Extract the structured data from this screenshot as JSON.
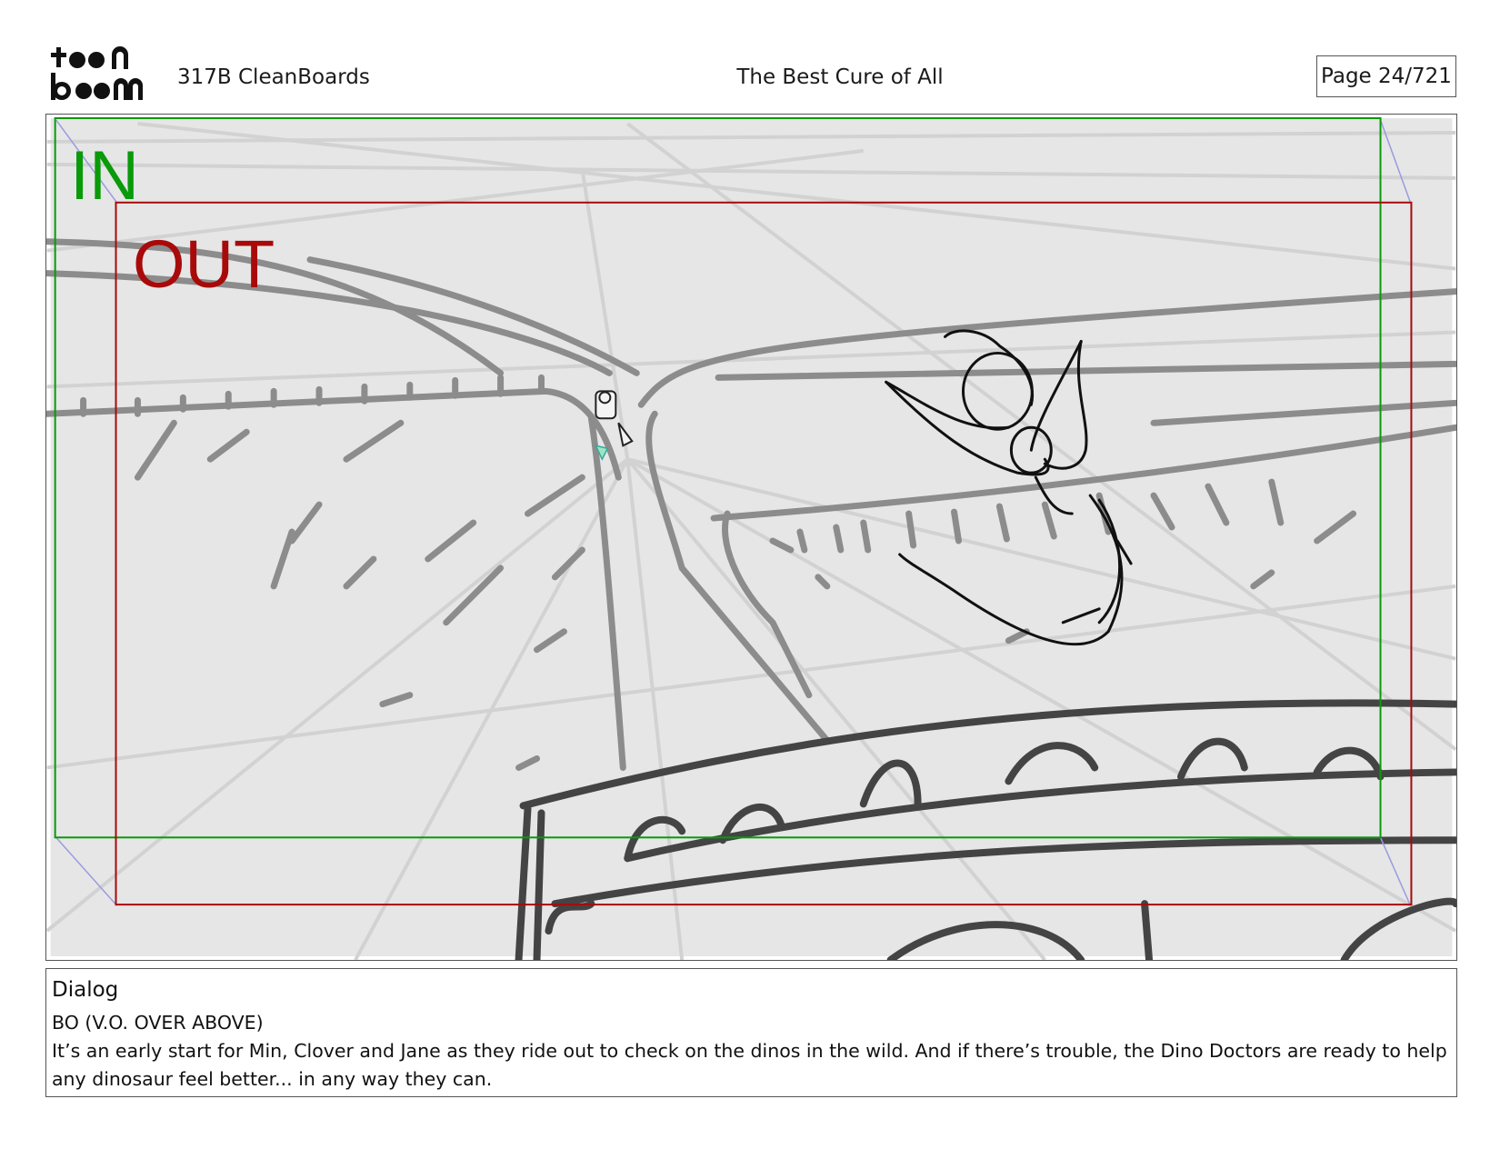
{
  "header": {
    "logo_text": "toon boom",
    "production": "317B  CleanBoards",
    "episode_title": "The Best Cure of All",
    "page": "Page  24/721"
  },
  "panel": {
    "in_label": "IN",
    "out_label": "OUT",
    "colors": {
      "in_frame": "#0a9a0a",
      "out_frame": "#a80a0a",
      "background": "#e6e6e6"
    }
  },
  "dialog": {
    "heading": "Dialog",
    "speaker": "BO (V.O. OVER ABOVE)",
    "text": "It’s an early start for Min, Clover and Jane as they ride out to check on the dinos in the wild. And if there’s trouble, the Dino Doctors are ready to help any dinosaur feel better... in any way they can."
  }
}
